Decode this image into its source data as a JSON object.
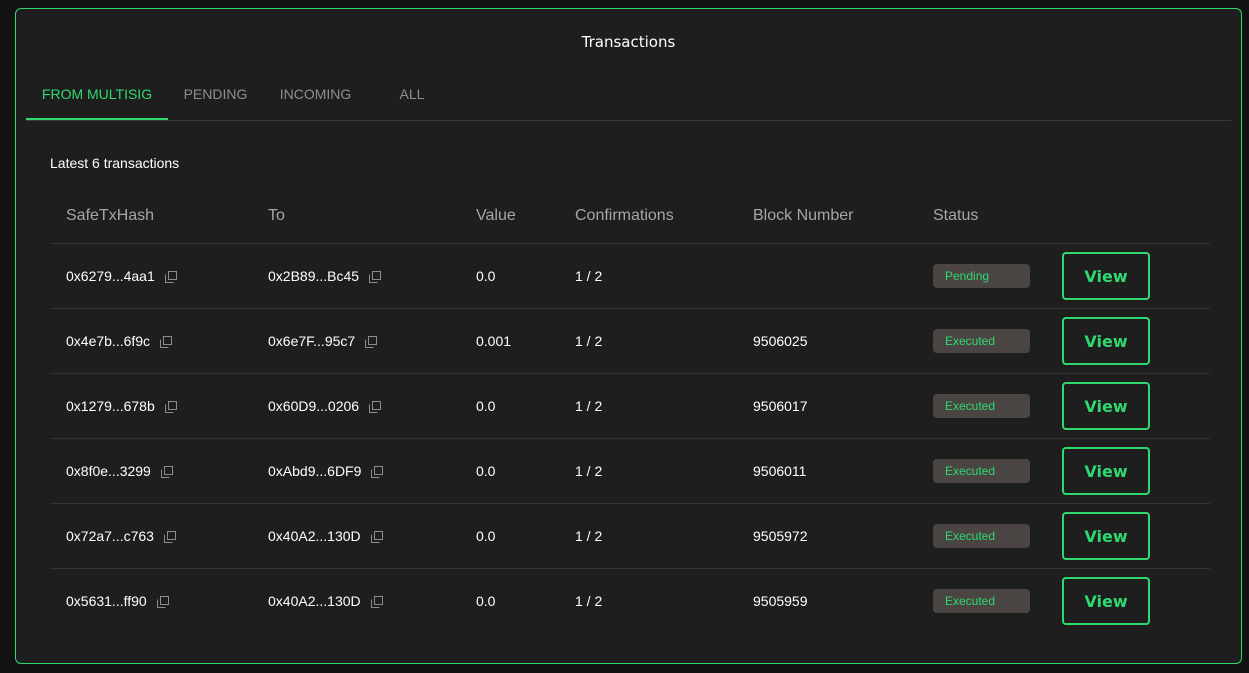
{
  "panel": {
    "title": "Transactions"
  },
  "tabs": [
    {
      "label": "FROM MULTISIG",
      "active": true
    },
    {
      "label": "PENDING",
      "active": false
    },
    {
      "label": "INCOMING",
      "active": false
    },
    {
      "label": "ALL",
      "active": false
    }
  ],
  "subtitle": "Latest 6 transactions",
  "table": {
    "headers": [
      "SafeTxHash",
      "To",
      "Value",
      "Confirmations",
      "Block Number",
      "Status"
    ],
    "rows": [
      {
        "hash": "0x6279...4aa1",
        "to": "0x2B89...Bc45",
        "value": "0.0",
        "confirmations": "1 / 2",
        "block": "",
        "status": "Pending",
        "action": "View"
      },
      {
        "hash": "0x4e7b...6f9c",
        "to": "0x6e7F...95c7",
        "value": "0.001",
        "confirmations": "1 / 2",
        "block": "9506025",
        "status": "Executed",
        "action": "View"
      },
      {
        "hash": "0x1279...678b",
        "to": "0x60D9...0206",
        "value": "0.0",
        "confirmations": "1 / 2",
        "block": "9506017",
        "status": "Executed",
        "action": "View"
      },
      {
        "hash": "0x8f0e...3299",
        "to": "0xAbd9...6DF9",
        "value": "0.0",
        "confirmations": "1 / 2",
        "block": "9506011",
        "status": "Executed",
        "action": "View"
      },
      {
        "hash": "0x72a7...c763",
        "to": "0x40A2...130D",
        "value": "0.0",
        "confirmations": "1 / 2",
        "block": "9505972",
        "status": "Executed",
        "action": "View"
      },
      {
        "hash": "0x5631...ff90",
        "to": "0x40A2...130D",
        "value": "0.0",
        "confirmations": "1 / 2",
        "block": "9505959",
        "status": "Executed",
        "action": "View"
      }
    ]
  },
  "icons": {
    "copy": "copy-icon"
  },
  "colors": {
    "accent": "#2fd970",
    "background": "#1e1e1e",
    "badge": "#4a4542"
  }
}
